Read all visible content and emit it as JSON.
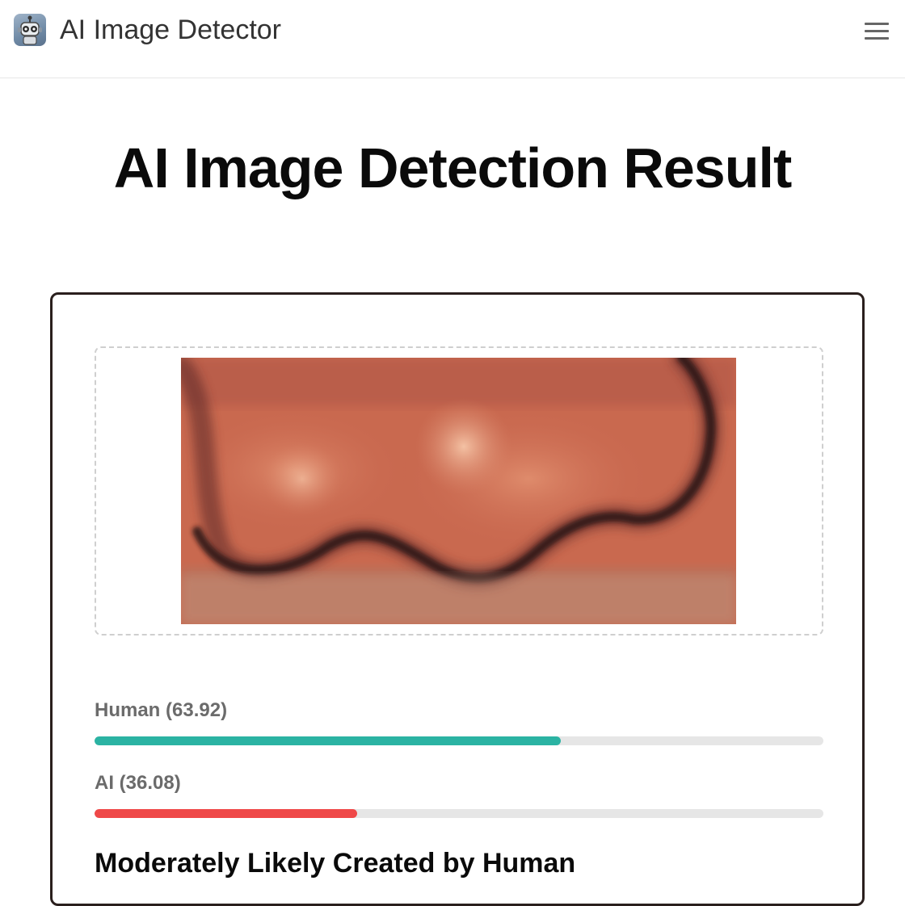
{
  "header": {
    "app_title": "AI Image Detector",
    "logo_icon": "robot-icon",
    "menu_icon": "hamburger-menu-icon"
  },
  "main": {
    "title": "AI Image Detection Result"
  },
  "result": {
    "human": {
      "name": "Human",
      "score_text": "(63.92)",
      "score": 63.92,
      "color": "#2bb3a3"
    },
    "ai": {
      "name": "AI",
      "score_text": "(36.08)",
      "score": 36.08,
      "color": "#ef4848"
    },
    "verdict": "Moderately Likely Created by Human"
  },
  "colors": {
    "card_border": "#2a1f1d",
    "track": "#e6e6e6"
  }
}
